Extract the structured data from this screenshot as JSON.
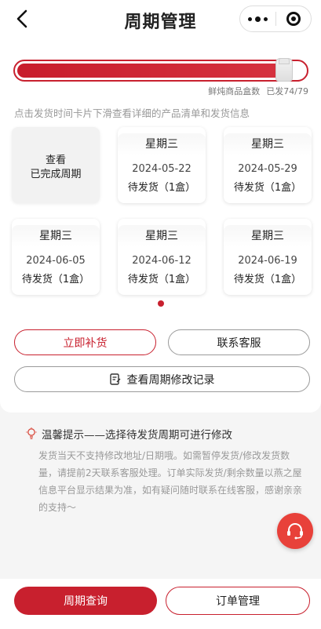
{
  "header": {
    "title": "周期管理",
    "back_icon": "chevron-left-icon",
    "more_icon": "more-dots-icon",
    "close_icon": "target-close-icon"
  },
  "progress": {
    "fraction": 0.937,
    "label": "鲜炖商品盒数",
    "shipped": "已发74/79",
    "fill_color": "#c8202e"
  },
  "hint": "点击发货时间卡片下滑查看详细的产品清单和发货信息",
  "completed_card": {
    "line1": "查看",
    "line2": "已完成周期"
  },
  "periods": [
    {
      "weekday": "星期三",
      "date": "2024-05-22",
      "status": "待发货（1盒）"
    },
    {
      "weekday": "星期三",
      "date": "2024-05-29",
      "status": "待发货（1盒）"
    },
    {
      "weekday": "星期三",
      "date": "2024-06-05",
      "status": "待发货（1盒）"
    },
    {
      "weekday": "星期三",
      "date": "2024-06-12",
      "status": "待发货（1盒）"
    },
    {
      "weekday": "星期三",
      "date": "2024-06-19",
      "status": "待发货（1盒）"
    }
  ],
  "actions": {
    "restock": "立即补货",
    "contact": "联系客服",
    "history": "查看周期修改记录"
  },
  "tips": {
    "title": "温馨提示——选择待发货周期可进行修改",
    "body": "发货当天不支持修改地址/日期哦。如需暂停发货/修改发货数量，请提前2天联系客服处理。订单实际发货/剩余数量以燕之屋信息平台显示结果为准，如有疑问随时联系在线客服，感谢亲亲的支持～"
  },
  "bottom_bar": {
    "period_query": "周期查询",
    "order_manage": "订单管理"
  },
  "colors": {
    "accent": "#c8202e",
    "fab": "#e8413a"
  }
}
